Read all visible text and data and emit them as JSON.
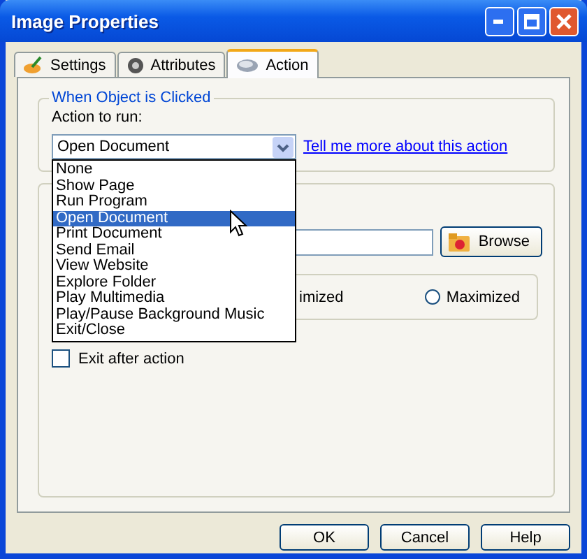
{
  "window": {
    "title": "Image Properties"
  },
  "tabs": [
    {
      "label": "Settings",
      "selected": false
    },
    {
      "label": "Attributes",
      "selected": false
    },
    {
      "label": "Action",
      "selected": true
    }
  ],
  "action_group": {
    "title": "When Object is Clicked",
    "label": "Action to run:",
    "combo": {
      "value": "Open Document",
      "expanded": true
    },
    "link": "Tell me more about this action",
    "dropdown": [
      {
        "label": "None",
        "selected": false
      },
      {
        "label": "Show Page",
        "selected": false
      },
      {
        "label": "Run Program",
        "selected": false
      },
      {
        "label": "Open Document",
        "selected": true
      },
      {
        "label": "Print Document",
        "selected": false
      },
      {
        "label": "Send Email",
        "selected": false
      },
      {
        "label": "View Website",
        "selected": false
      },
      {
        "label": "Explore Folder",
        "selected": false
      },
      {
        "label": "Play Multimedia",
        "selected": false
      },
      {
        "label": "Play/Pause Background Music",
        "selected": false
      },
      {
        "label": "Exit/Close",
        "selected": false
      }
    ]
  },
  "target_group": {
    "browse_button": "Browse",
    "partial_label": "imized",
    "radio": {
      "label": "Maximized",
      "selected": false
    },
    "exit_after_action": {
      "label": "Exit after action",
      "checked": false
    }
  },
  "buttons": [
    "OK",
    "Cancel",
    "Help"
  ]
}
